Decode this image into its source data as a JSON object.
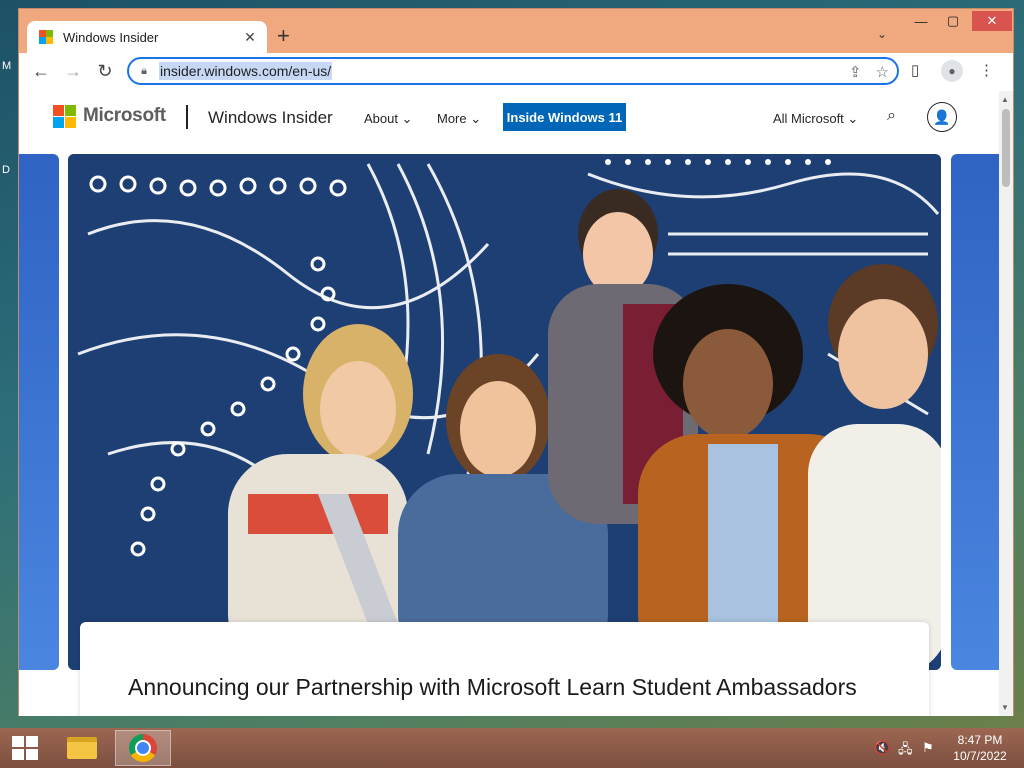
{
  "desktop": {
    "letter_1": "M",
    "letter_2": "D"
  },
  "browser": {
    "tab": {
      "title": "Windows Insider",
      "close": "✕"
    },
    "new_tab": "+",
    "tab_search": "⌄",
    "window_controls": {
      "minimize": "—",
      "maximize": "▢",
      "close": "✕"
    },
    "nav": {
      "back": "←",
      "forward": "→",
      "reload": "↻"
    },
    "address": {
      "url": "insider.windows.com/en-us/"
    },
    "icons": {
      "share": "⇪",
      "bookmark": "☆",
      "sidepanel": "▯",
      "menu": "⋮",
      "profile": "●"
    }
  },
  "site": {
    "brand": "Microsoft",
    "name": "Windows Insider",
    "nav": [
      {
        "label": "About ⌄"
      },
      {
        "label": "More ⌄"
      }
    ],
    "cta": "Inside Windows 11",
    "all_microsoft": "All Microsoft ⌄",
    "search_icon": "⌕",
    "account_icon": "👤",
    "headline": "Announcing our Partnership with Microsoft Learn Student Ambassadors"
  },
  "taskbar": {
    "tray_icons": {
      "volume": "🔇",
      "network": "🖧",
      "flag": "⚑"
    },
    "time": "8:47 PM",
    "date": "10/7/2022"
  },
  "colors": {
    "window_frame": "#f0a87f",
    "accent_blue": "#0067b8",
    "hero_bg": "#1e3f74"
  }
}
